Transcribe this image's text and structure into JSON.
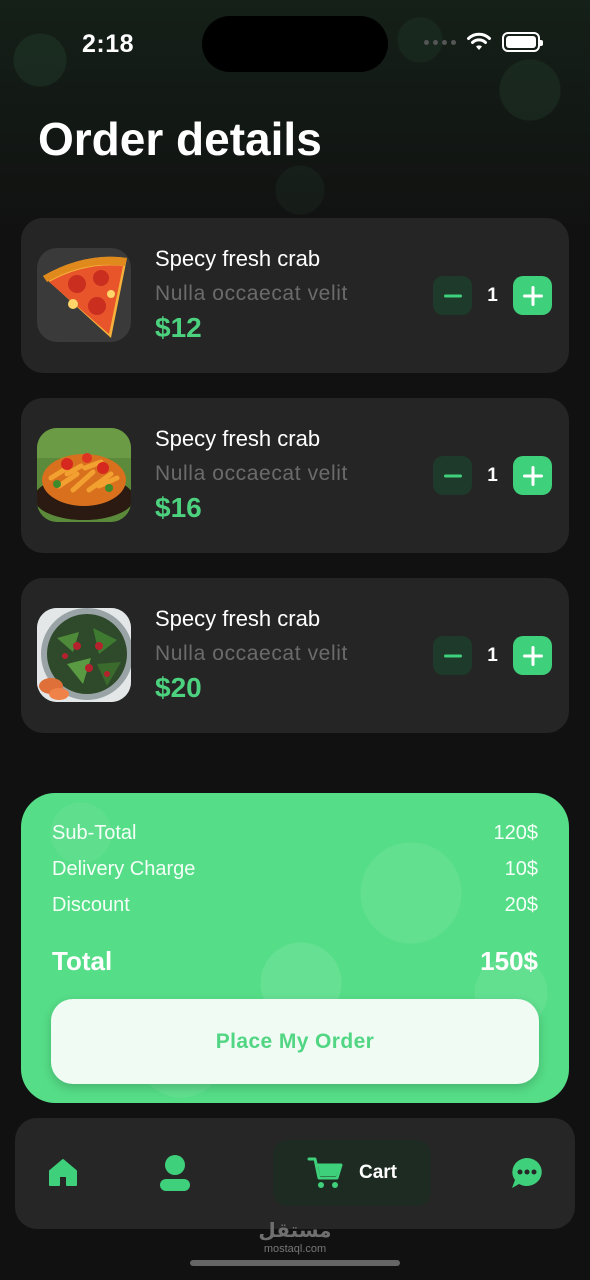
{
  "status": {
    "time": "2:18"
  },
  "header": {
    "title": "Order details"
  },
  "items": [
    {
      "name": "Specy fresh crab",
      "desc": "Nulla occaecat velit",
      "price": "$12",
      "qty": "1",
      "image": "pizza-slice"
    },
    {
      "name": "Specy fresh crab",
      "desc": "Nulla occaecat velit",
      "price": "$16",
      "qty": "1",
      "image": "pasta-plate"
    },
    {
      "name": "Specy fresh crab",
      "desc": "Nulla occaecat velit",
      "price": "$20",
      "qty": "1",
      "image": "salad-bowl"
    }
  ],
  "summary": {
    "subtotal_label": "Sub-Total",
    "subtotal_value": "120$",
    "delivery_label": "Delivery Charge",
    "delivery_value": "10$",
    "discount_label": "Discount",
    "discount_value": "20$",
    "total_label": "Total",
    "total_value": "150$",
    "cta_label": "Place My Order"
  },
  "nav": {
    "cart_label": "Cart",
    "icons": [
      "home-icon",
      "profile-icon",
      "cart-icon",
      "chat-icon"
    ]
  },
  "watermark": {
    "arabic": "مستقل",
    "latin": "mostaql.com"
  },
  "colors": {
    "accent": "#4cd27f",
    "card": "#252525",
    "background": "#111111",
    "summary": "#55dd87"
  }
}
